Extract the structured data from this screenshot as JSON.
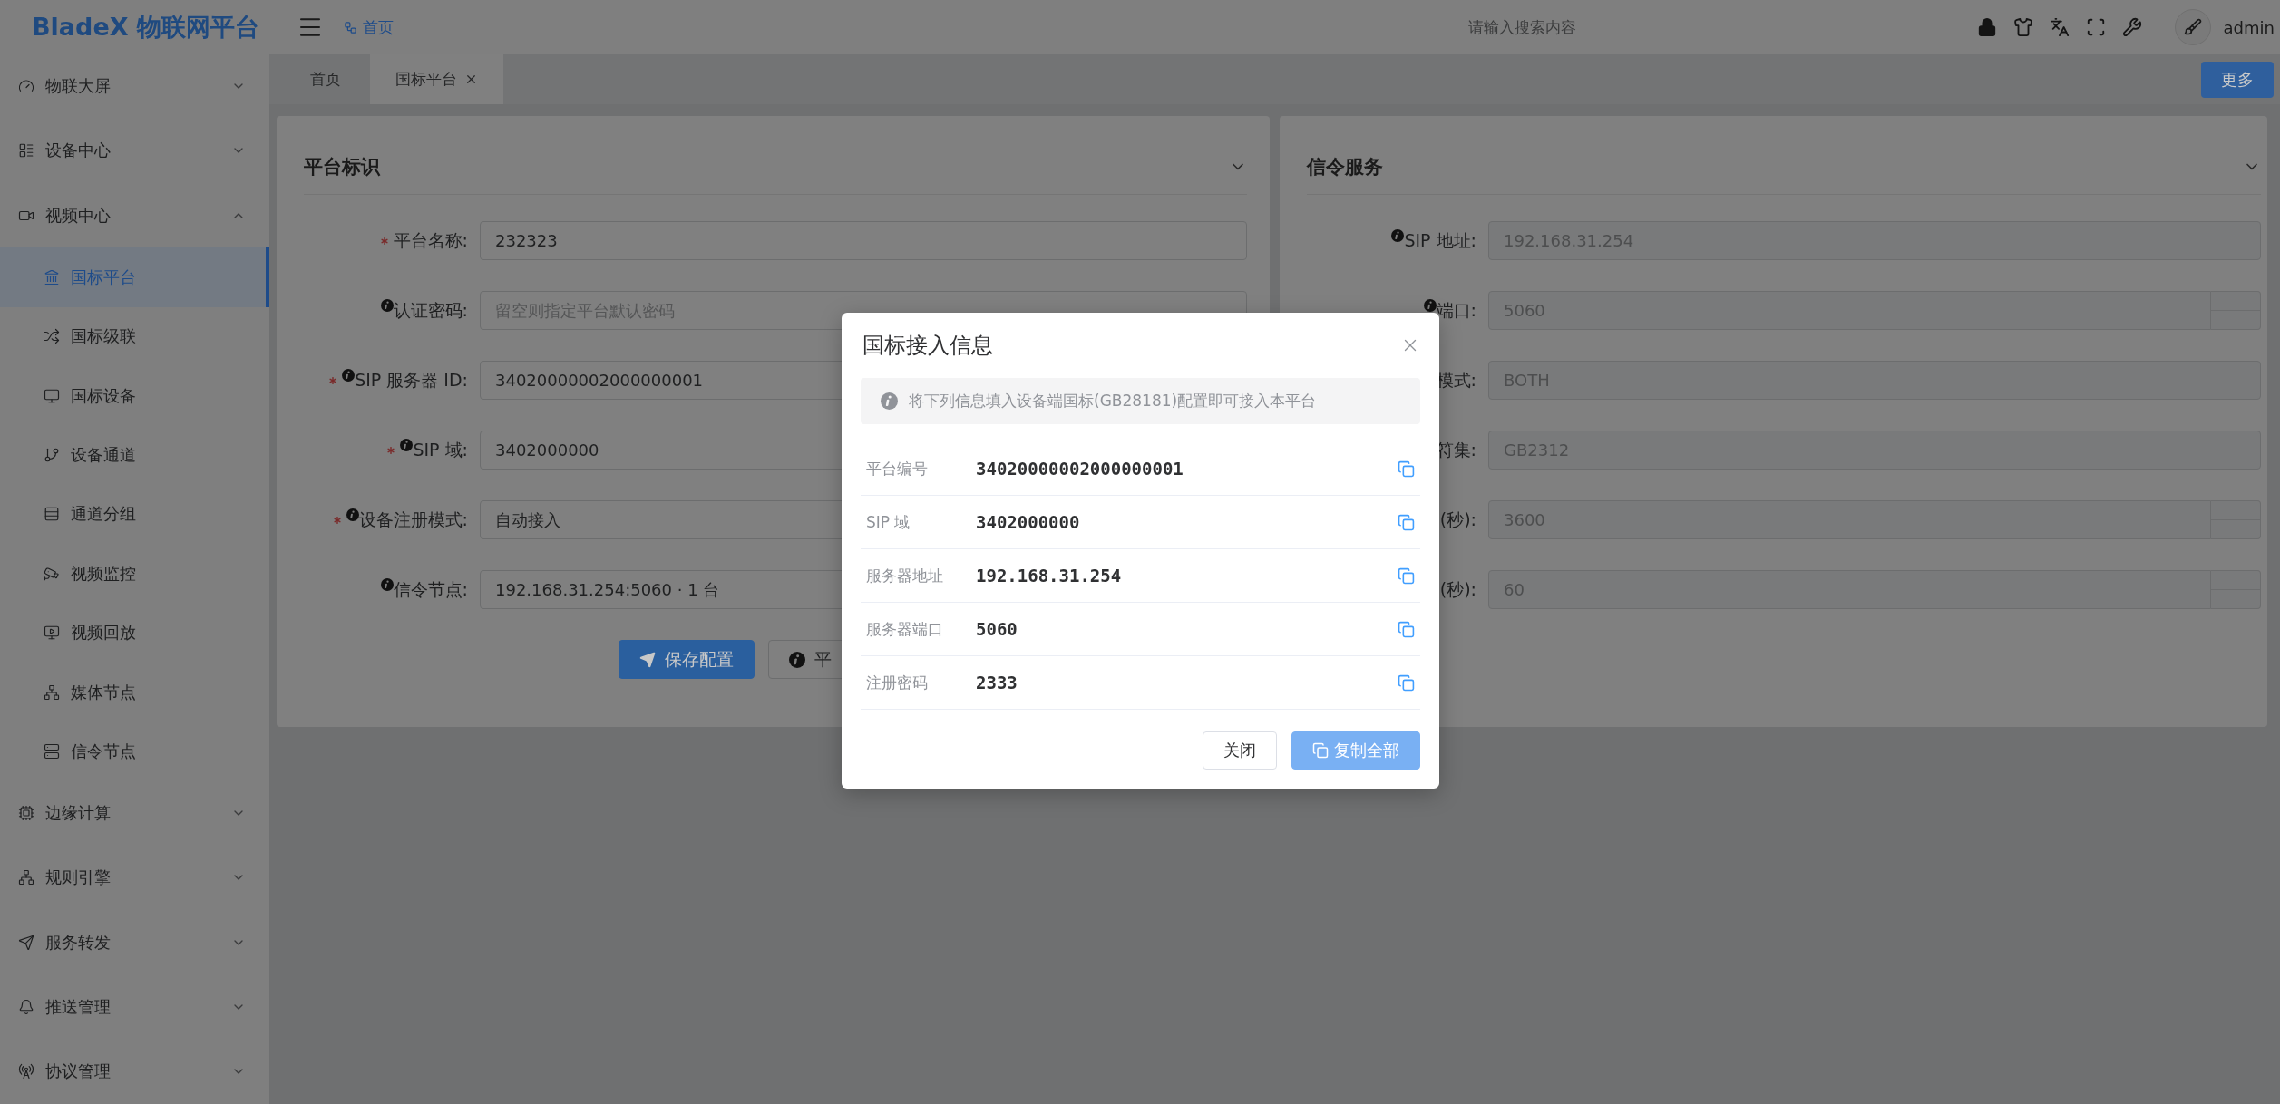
{
  "header": {
    "logo": "BladeX 物联网平台",
    "breadcrumb": "首页",
    "search": {
      "placeholder": "请输入搜索内容"
    },
    "user": "admin"
  },
  "sidebar": {
    "items": [
      {
        "label": "物联大屏",
        "expanded": false
      },
      {
        "label": "设备中心",
        "expanded": false
      },
      {
        "label": "视频中心",
        "expanded": true,
        "children": [
          {
            "label": "国标平台",
            "selected": true
          },
          {
            "label": "国标级联",
            "selected": false
          },
          {
            "label": "国标设备",
            "selected": false
          },
          {
            "label": "设备通道",
            "selected": false
          },
          {
            "label": "通道分组",
            "selected": false
          },
          {
            "label": "视频监控",
            "selected": false
          },
          {
            "label": "视频回放",
            "selected": false
          },
          {
            "label": "媒体节点",
            "selected": false
          },
          {
            "label": "信令节点",
            "selected": false
          }
        ]
      },
      {
        "label": "边缘计算",
        "expanded": false
      },
      {
        "label": "规则引擎",
        "expanded": false
      },
      {
        "label": "服务转发",
        "expanded": false
      },
      {
        "label": "推送管理",
        "expanded": false
      },
      {
        "label": "协议管理",
        "expanded": false
      }
    ]
  },
  "tabs": [
    {
      "label": "首页",
      "selected": false,
      "closable": false
    },
    {
      "label": "国标平台",
      "selected": true,
      "closable": true
    }
  ],
  "more_button": "更多",
  "platform_card": {
    "title": "平台标识",
    "fields": [
      {
        "label": "平台名称:",
        "required": true,
        "info": false,
        "value": "232323"
      },
      {
        "label": "认证密码:",
        "required": false,
        "info": true,
        "placeholder": "留空则指定平台默认密码"
      },
      {
        "label": "SIP 服务器 ID:",
        "required": true,
        "info": true,
        "value": "34020000002000000001"
      },
      {
        "label": "SIP 域:",
        "required": true,
        "info": true,
        "value": "3402000000"
      },
      {
        "label": "设备注册模式:",
        "required": true,
        "info": true,
        "value": "自动接入"
      },
      {
        "label": "信令节点:",
        "required": false,
        "info": true,
        "value": "192.168.31.254:5060 · 1 台"
      }
    ],
    "buttons": [
      {
        "label": "保存配置",
        "kind": "primary"
      },
      {
        "label": "平",
        "kind": "info"
      }
    ]
  },
  "signaling_card": {
    "title": "信令服务",
    "fields": [
      {
        "label": "SIP 地址:",
        "info": true,
        "kind": "text",
        "disabled": true,
        "value": "192.168.31.254"
      },
      {
        "label": "端口:",
        "info": true,
        "kind": "number",
        "disabled": true,
        "value": "5060"
      },
      {
        "label": "模式:",
        "info": false,
        "kind": "text",
        "disabled": true,
        "value": "BOTH"
      },
      {
        "label": "符集:",
        "info": false,
        "kind": "text",
        "disabled": true,
        "value": "GB2312"
      },
      {
        "label": "(秒):",
        "info": false,
        "kind": "number",
        "disabled": true,
        "value": "3600"
      },
      {
        "label": "(秒):",
        "info": false,
        "kind": "number",
        "disabled": true,
        "value": "60"
      }
    ]
  },
  "dialog": {
    "title": "国标接入信息",
    "notice": "将下列信息填入设备端国标(GB28181)配置即可接入本平台",
    "rows": [
      {
        "label": "平台编号",
        "value": "34020000002000000001"
      },
      {
        "label": "SIP 域",
        "value": "3402000000"
      },
      {
        "label": "服务器地址",
        "value": "192.168.31.254"
      },
      {
        "label": "服务器端口",
        "value": "5060"
      },
      {
        "label": "注册密码",
        "value": "2333"
      }
    ],
    "buttons": [
      {
        "label": "关闭",
        "kind": "default"
      },
      {
        "label": "复制全部",
        "kind": "primary"
      }
    ]
  }
}
